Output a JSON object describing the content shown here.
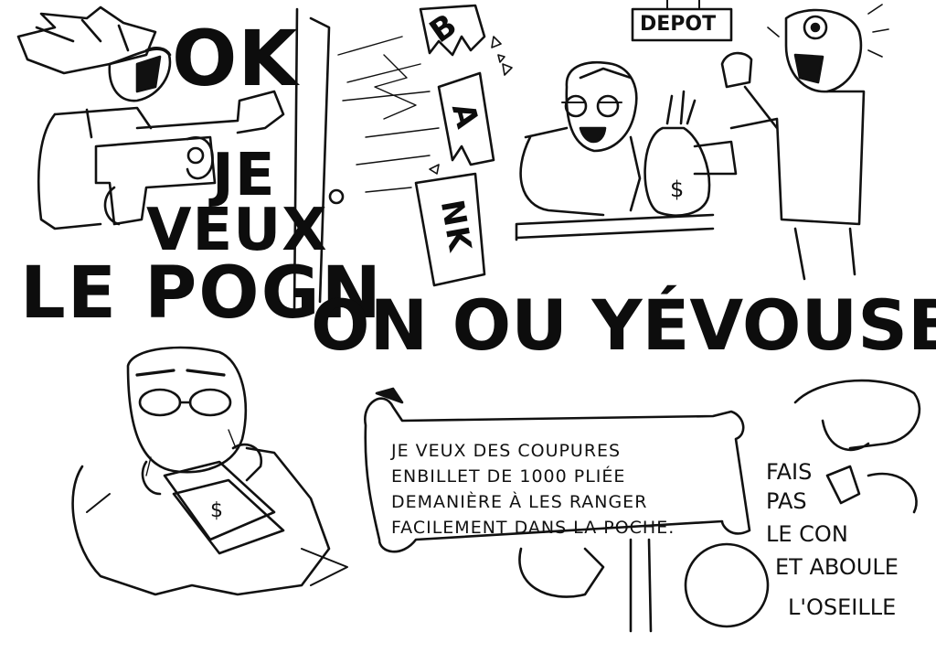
{
  "panel_top_left": {
    "shout_ok": "OK",
    "shout_je": "JE",
    "shout_veux": "VEUX"
  },
  "panel_top_middle": {
    "bank_sign_pieces": [
      "B",
      "A",
      "NK"
    ]
  },
  "panel_top_right": {
    "counter_sign": "DEPOT",
    "money_bag_symbol": "$"
  },
  "headline": {
    "left": "LE POGN",
    "right": "ON OU YÉVOUSBUTE"
  },
  "panel_bottom_left": {
    "banknote_symbol": "$"
  },
  "panel_bottom_right": {
    "sign_lines": [
      "JE VEUX DES COUPURES",
      "ENBILLET DE 1000 PLIÉE",
      "DEMANIÈRE À LES RANGER",
      "FACILEMENT DANS LA POCHE."
    ],
    "side_lines": [
      "FAIS",
      "PAS",
      "LE CON",
      "ET ABOULE",
      "L'OSEILLE"
    ]
  },
  "colors": {
    "ink": "#111111",
    "paper": "#ffffff"
  }
}
